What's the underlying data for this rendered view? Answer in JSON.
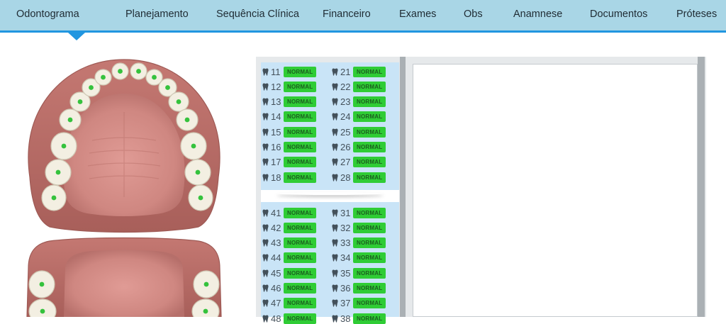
{
  "nav": {
    "tabs": [
      {
        "label": "Odontograma",
        "active": true
      },
      {
        "label": "Planejamento"
      },
      {
        "label": "Sequência Clínica"
      },
      {
        "label": "Financeiro"
      },
      {
        "label": "Exames"
      },
      {
        "label": "Obs"
      },
      {
        "label": "Anamnese"
      },
      {
        "label": "Documentos"
      },
      {
        "label": "Próteses"
      }
    ]
  },
  "colors": {
    "nav_bg": "#a9d6e6",
    "nav_accent": "#2196e0",
    "status_normal": "#2fcc35",
    "list_bg": "#c9e4f7",
    "gum": "#c97d78",
    "tooth": "#f3efe2",
    "tooth_marker": "#35c23d"
  },
  "tooth_icon": "tooth-icon",
  "teeth": {
    "upper_right": [
      {
        "num": "11",
        "status": "NORMAL"
      },
      {
        "num": "12",
        "status": "NORMAL"
      },
      {
        "num": "13",
        "status": "NORMAL"
      },
      {
        "num": "14",
        "status": "NORMAL"
      },
      {
        "num": "15",
        "status": "NORMAL"
      },
      {
        "num": "16",
        "status": "NORMAL"
      },
      {
        "num": "17",
        "status": "NORMAL"
      },
      {
        "num": "18",
        "status": "NORMAL"
      }
    ],
    "upper_left": [
      {
        "num": "21",
        "status": "NORMAL"
      },
      {
        "num": "22",
        "status": "NORMAL"
      },
      {
        "num": "23",
        "status": "NORMAL"
      },
      {
        "num": "24",
        "status": "NORMAL"
      },
      {
        "num": "25",
        "status": "NORMAL"
      },
      {
        "num": "26",
        "status": "NORMAL"
      },
      {
        "num": "27",
        "status": "NORMAL"
      },
      {
        "num": "28",
        "status": "NORMAL"
      }
    ],
    "lower_right": [
      {
        "num": "41",
        "status": "NORMAL"
      },
      {
        "num": "42",
        "status": "NORMAL"
      },
      {
        "num": "43",
        "status": "NORMAL"
      },
      {
        "num": "44",
        "status": "NORMAL"
      },
      {
        "num": "45",
        "status": "NORMAL"
      },
      {
        "num": "46",
        "status": "NORMAL"
      },
      {
        "num": "47",
        "status": "NORMAL"
      },
      {
        "num": "48",
        "status": "NORMAL"
      }
    ],
    "lower_left": [
      {
        "num": "31",
        "status": "NORMAL"
      },
      {
        "num": "32",
        "status": "NORMAL"
      },
      {
        "num": "33",
        "status": "NORMAL"
      },
      {
        "num": "34",
        "status": "NORMAL"
      },
      {
        "num": "35",
        "status": "NORMAL"
      },
      {
        "num": "36",
        "status": "NORMAL"
      },
      {
        "num": "37",
        "status": "NORMAL"
      },
      {
        "num": "38",
        "status": "NORMAL"
      }
    ]
  }
}
